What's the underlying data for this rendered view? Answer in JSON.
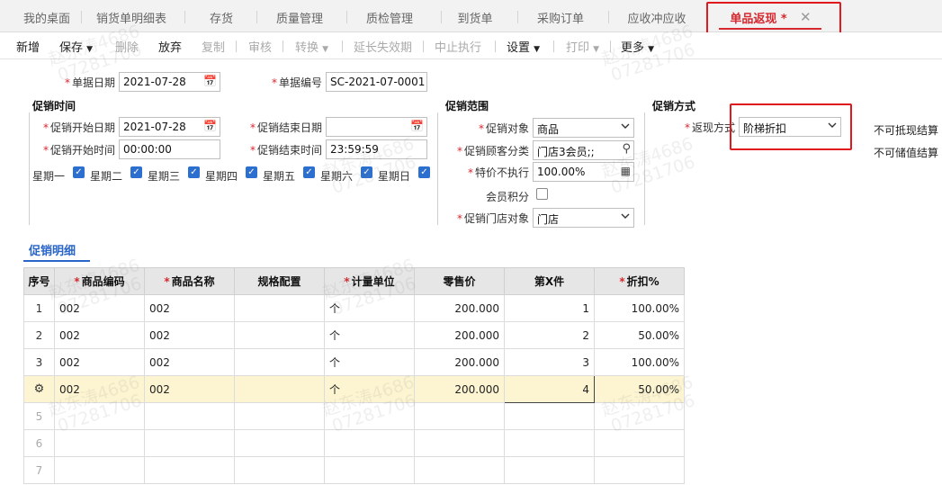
{
  "tabs": [
    {
      "label": "我的桌面"
    },
    {
      "label": "销货单明细表"
    },
    {
      "label": "存货"
    },
    {
      "label": "质量管理"
    },
    {
      "label": "质检管理"
    },
    {
      "label": "到货单"
    },
    {
      "label": "采购订单"
    },
    {
      "label": "应收冲应收"
    },
    {
      "label": "单品返现 *"
    }
  ],
  "toolbar": {
    "new": "新增",
    "save": "保存",
    "delete": "删除",
    "discard": "放弃",
    "copy": "复制",
    "audit": "审核",
    "convert": "转换",
    "extend": "延长失效期",
    "stop": "中止执行",
    "settings": "设置",
    "print": "打印",
    "more": "更多"
  },
  "form": {
    "doc_date_label": "单据日期",
    "doc_date": "2021-07-28",
    "doc_no_label": "单据编号",
    "doc_no": "SC-2021-07-0001",
    "promo_time_title": "促销时间",
    "start_date_label": "促销开始日期",
    "start_date": "2021-07-28",
    "end_date_label": "促销结束日期",
    "end_date": "",
    "start_time_label": "促销开始时间",
    "start_time": "00:00:00",
    "end_time_label": "促销结束时间",
    "end_time": "23:59:59",
    "weekdays": [
      "星期一",
      "星期二",
      "星期三",
      "星期四",
      "星期五",
      "星期六",
      "星期日"
    ],
    "scope_title": "促销范围",
    "target_label": "促销对象",
    "target": "商品",
    "customer_class_label": "促销顾客分类",
    "customer_class": "门店3会员;;",
    "special_price_label": "特价不执行",
    "special_price": "100.00%",
    "member_points_label": "会员积分",
    "store_target_label": "促销门店对象",
    "store_target": "门店",
    "method_title": "促销方式",
    "cashback_label": "返现方式",
    "cashback": "阶梯折扣",
    "note1": "不可抵现结算",
    "note2": "不可储值结算"
  },
  "detail_tab": "促销明细",
  "grid": {
    "headers": [
      "序号",
      "商品编码",
      "商品名称",
      "规格配置",
      "计量单位",
      "零售价",
      "第X件",
      "折扣%"
    ],
    "required": [
      false,
      true,
      true,
      false,
      true,
      false,
      false,
      true
    ],
    "rows": [
      [
        "1",
        "002",
        "002",
        "",
        "个",
        "200.000",
        "1",
        "100.00%"
      ],
      [
        "2",
        "002",
        "002",
        "",
        "个",
        "200.000",
        "2",
        "50.00%"
      ],
      [
        "3",
        "002",
        "002",
        "",
        "个",
        "200.000",
        "3",
        "100.00%"
      ],
      [
        "",
        "002",
        "002",
        "",
        "个",
        "200.000",
        "4",
        "50.00%"
      ],
      [
        "5",
        "",
        "",
        "",
        "",
        "",
        "",
        ""
      ],
      [
        "6",
        "",
        "",
        "",
        "",
        "",
        "",
        ""
      ],
      [
        "7",
        "",
        "",
        "",
        "",
        "",
        "",
        ""
      ]
    ]
  },
  "watermark": {
    "name": "赵东涛4686",
    "code": "07281706"
  }
}
